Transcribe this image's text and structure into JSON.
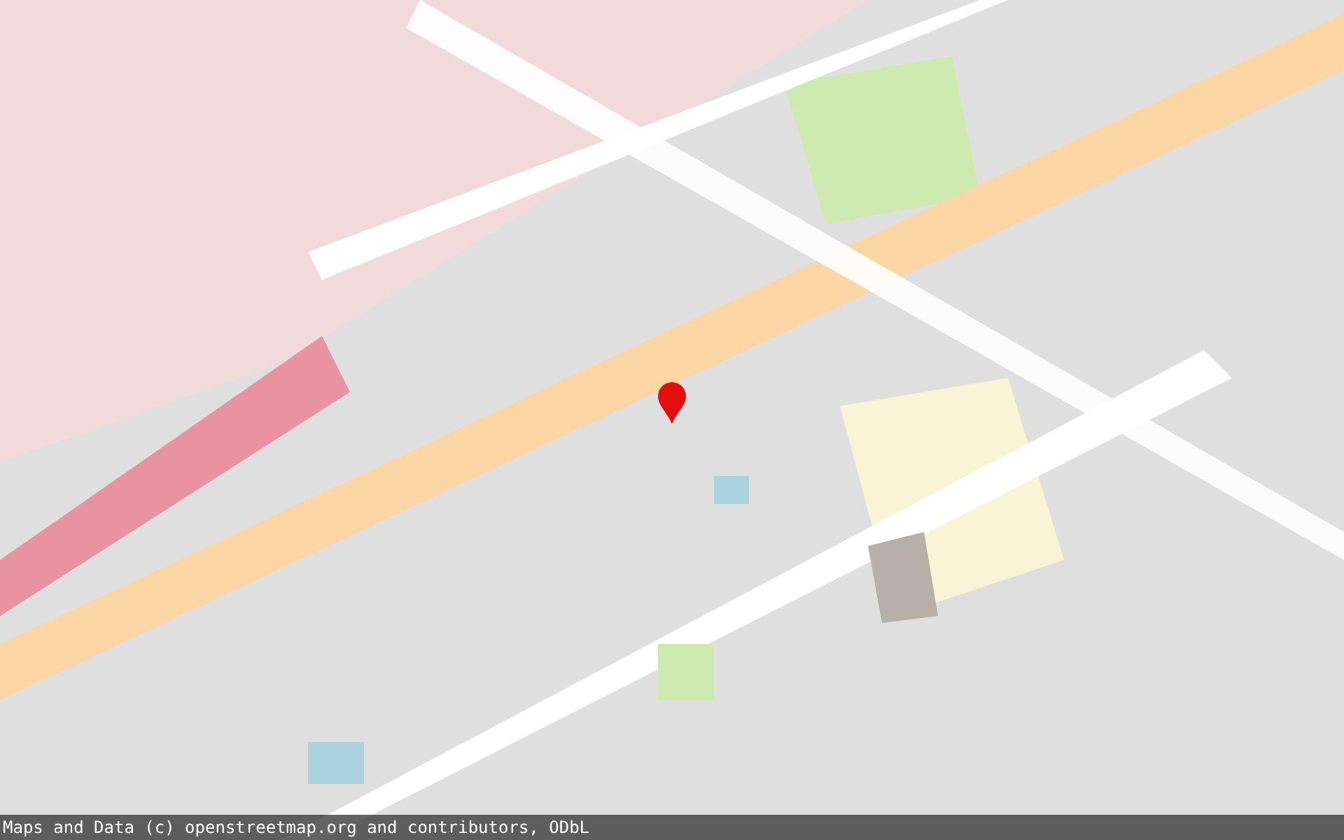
{
  "attribution": "Maps and Data (c) openstreetmap.org and contributors, ODbL"
}
